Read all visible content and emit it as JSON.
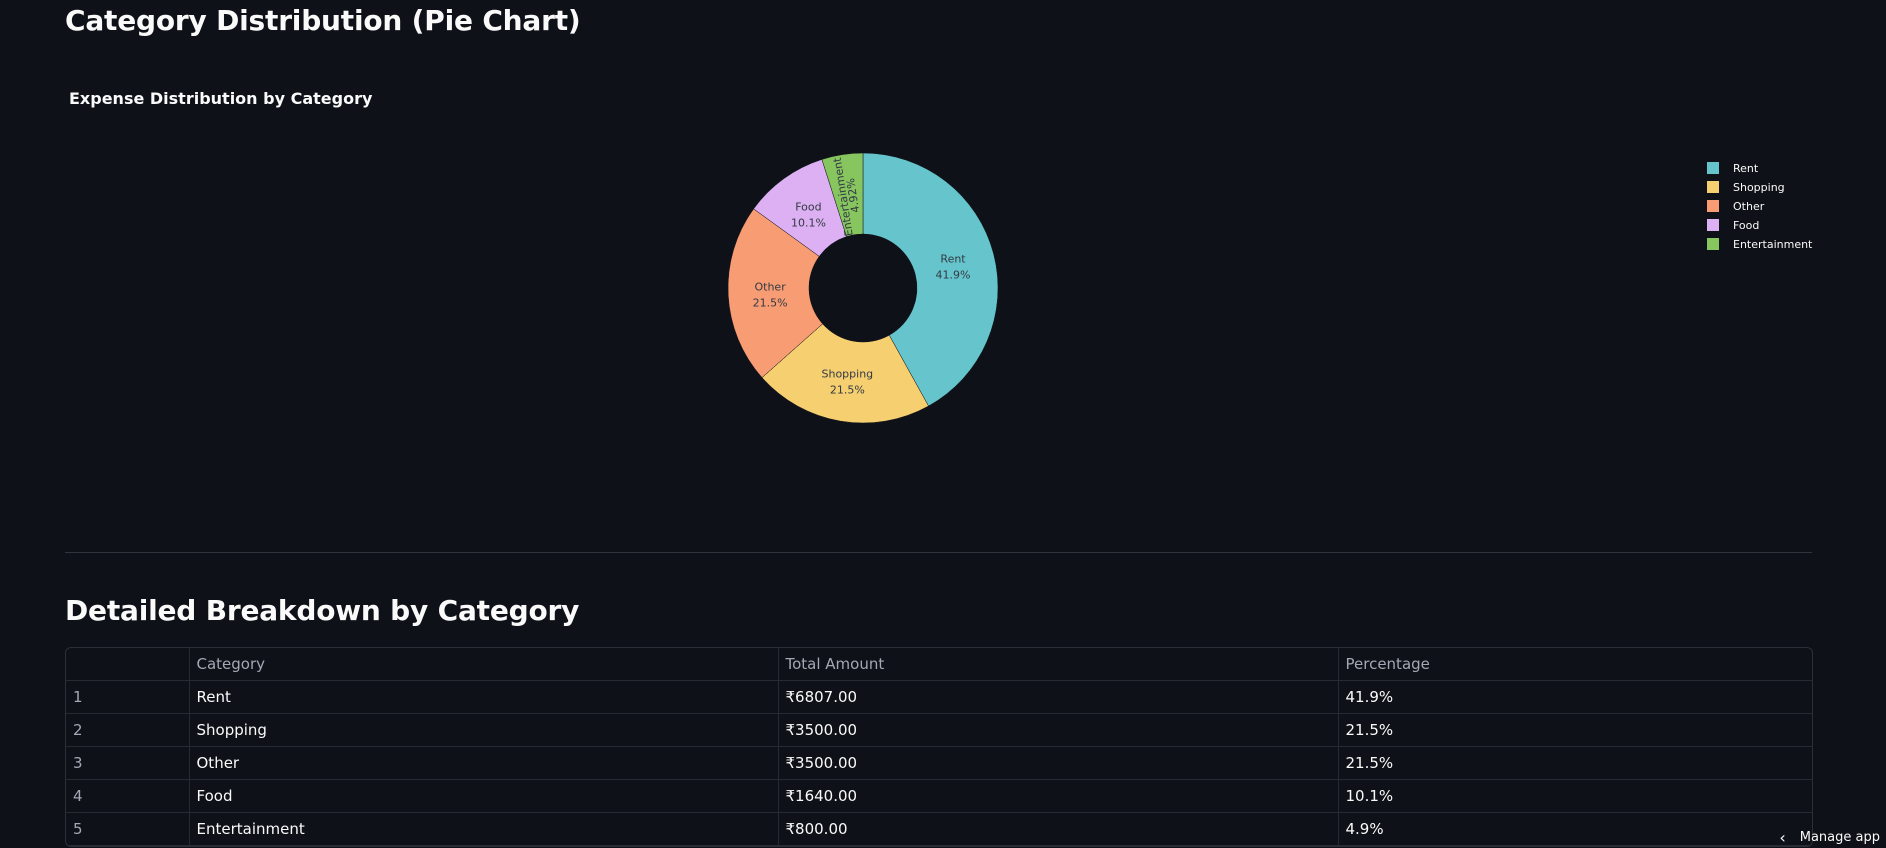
{
  "pie_section": {
    "heading": "Category Distribution (Pie Chart)"
  },
  "chart_data": {
    "type": "pie",
    "title": "Expense Distribution by Category",
    "hole": true,
    "legend_position": "top-right",
    "slices": [
      {
        "label": "Rent",
        "value": 41.9,
        "percent_text": "41.9%",
        "color": "#66c5cc"
      },
      {
        "label": "Shopping",
        "value": 21.5,
        "percent_text": "21.5%",
        "color": "#f6cf71"
      },
      {
        "label": "Other",
        "value": 21.5,
        "percent_text": "21.5%",
        "color": "#f89c74"
      },
      {
        "label": "Food",
        "value": 10.1,
        "percent_text": "10.1%",
        "color": "#dcb0f2"
      },
      {
        "label": "Entertainment",
        "value": 4.92,
        "percent_text": "4.92%",
        "color": "#87c55f"
      }
    ]
  },
  "table_section": {
    "heading": "Detailed Breakdown by Category",
    "columns": [
      "",
      "Category",
      "Total Amount",
      "Percentage"
    ],
    "rows": [
      [
        "1",
        "Rent",
        "₹6807.00",
        "41.9%"
      ],
      [
        "2",
        "Shopping",
        "₹3500.00",
        "21.5%"
      ],
      [
        "3",
        "Other",
        "₹3500.00",
        "21.5%"
      ],
      [
        "4",
        "Food",
        "₹1640.00",
        "10.1%"
      ],
      [
        "5",
        "Entertainment",
        "₹800.00",
        "4.9%"
      ]
    ]
  },
  "footer": {
    "manage_app_label": "Manage app",
    "manage_icon": "chevron-left-icon"
  },
  "colors": {
    "background": "#0e1117",
    "text": "#fafafa",
    "muted": "#a3a8b4",
    "border": "#262a33"
  }
}
